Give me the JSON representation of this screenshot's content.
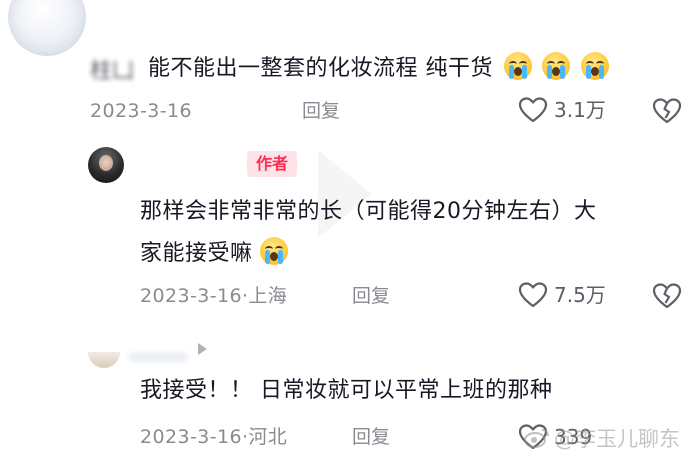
{
  "comments": [
    {
      "username": "",
      "name_prefix": "柱凵",
      "text": "能不能出一整套的化妆流程 纯干货",
      "emoji_count": 3,
      "date": "2023-3-16",
      "location": "",
      "reply_label": "回复",
      "like_count": "3.1万"
    },
    {
      "author_badge": "作者",
      "text_line1": "那样会非常非常的长（可能得20分钟左右）大",
      "text_line2": "家能接受嘛",
      "date": "2023-3-16",
      "location": "上海",
      "reply_label": "回复",
      "like_count": "7.5万"
    },
    {
      "text": "我接受！！ 日常妆就可以平常上班的那种",
      "date": "2023-3-16",
      "location": "河北",
      "reply_label": "回复",
      "like_count": "339"
    }
  ],
  "watermark": {
    "text": "@李玉儿聊东"
  },
  "icons": {
    "like": "heart-outline-icon",
    "dislike": "broken-heart-icon",
    "emoji": "loudly-crying-face-icon",
    "play": "play-triangle-icon",
    "watermark_logo": "weibo-logo-icon"
  },
  "colors": {
    "author_badge_bg": "#fde3e7",
    "author_badge_text": "#fe2c55",
    "meta_gray": "#8a8b91"
  }
}
